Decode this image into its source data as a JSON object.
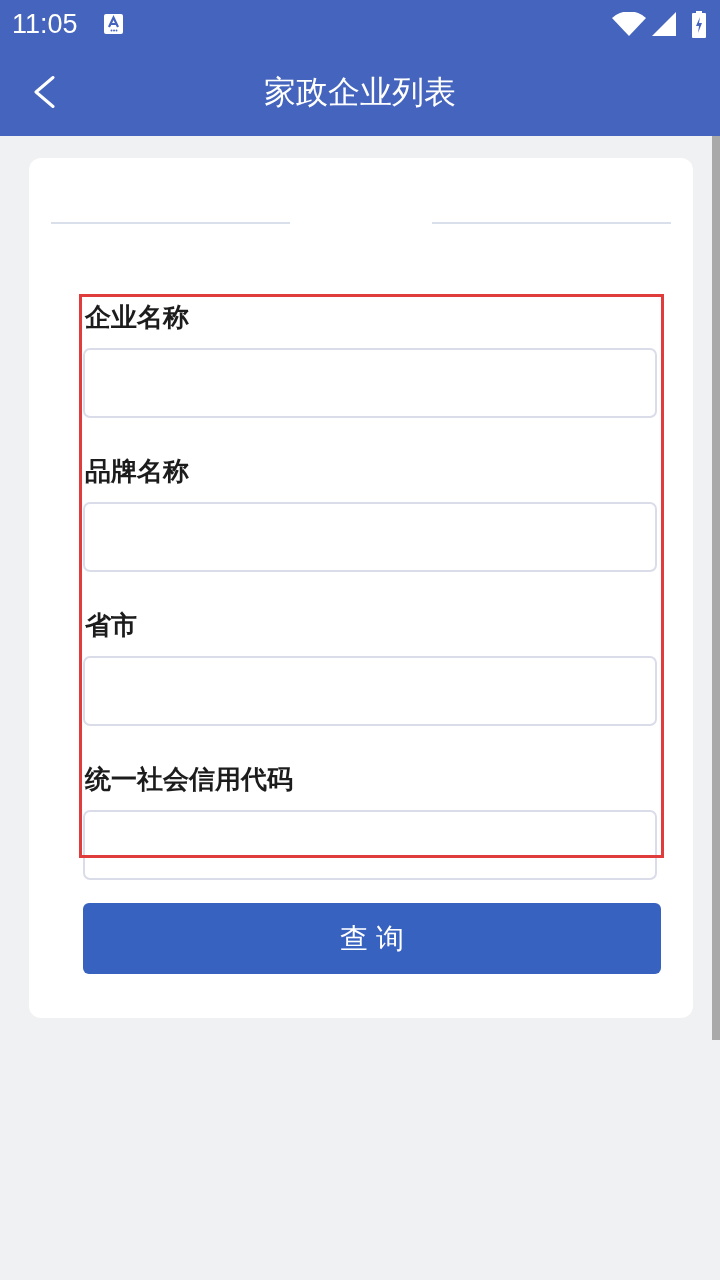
{
  "status_bar": {
    "time": "11:05"
  },
  "toolbar": {
    "title": "家政企业列表"
  },
  "form": {
    "fields": [
      {
        "label": "企业名称"
      },
      {
        "label": "品牌名称"
      },
      {
        "label": "省市"
      },
      {
        "label": "统一社会信用代码"
      }
    ],
    "submit_button": "查 询"
  }
}
